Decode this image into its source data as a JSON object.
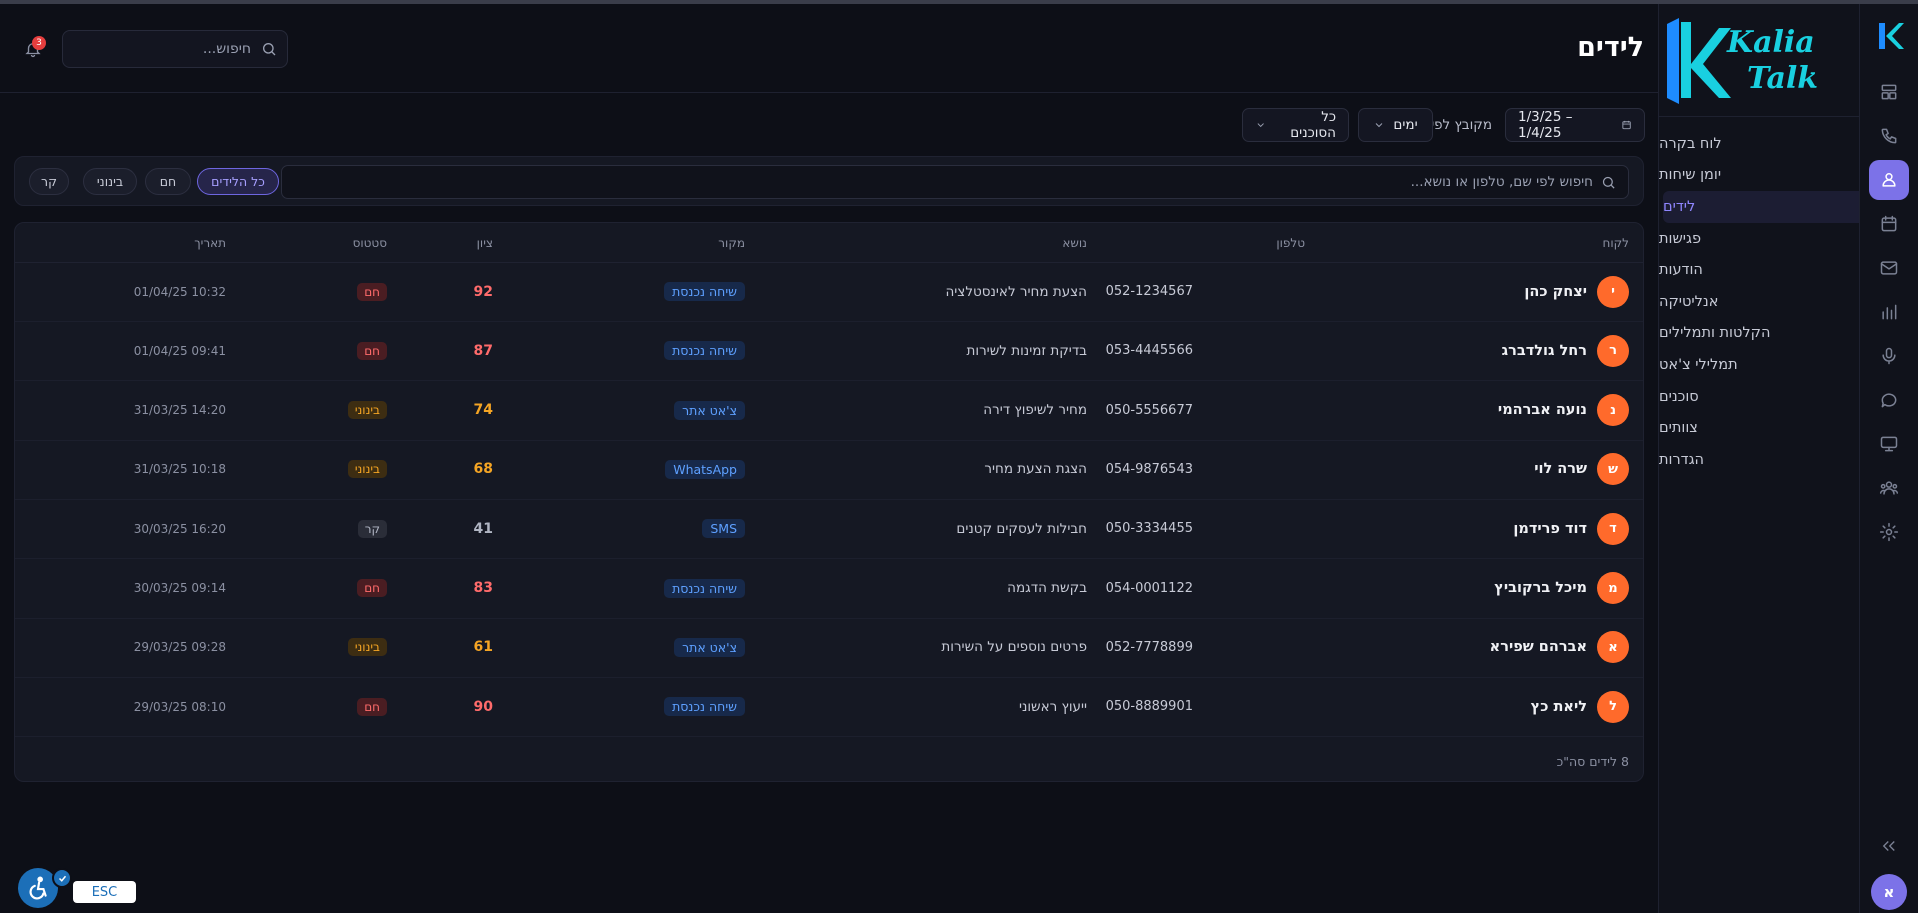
{
  "app": {
    "brand_line1": "Kalia",
    "brand_line2": "Talk",
    "user_initial": "א"
  },
  "colors": {
    "accent": "#7c72e8",
    "avatar": "#ff6a2b",
    "hot": "#ff6b6b",
    "mid": "#f5a524",
    "cold": "#b0b5c3",
    "source": "#5ea0ff"
  },
  "rail_icons": [
    "dashboard-icon",
    "phone-icon",
    "leads-icon",
    "calendar-icon",
    "mail-icon",
    "analytics-icon",
    "mic-icon",
    "chat-icon",
    "monitor-icon",
    "agents-icon",
    "settings-icon"
  ],
  "nav": {
    "items": [
      {
        "label": "לוח בקרה",
        "active": false
      },
      {
        "label": "יומן שיחות",
        "active": false
      },
      {
        "label": "לידים",
        "active": true
      },
      {
        "label": "פגישות",
        "active": false
      },
      {
        "label": "הודעות",
        "active": false
      },
      {
        "label": "אנליטיקה",
        "active": false
      },
      {
        "label": "הקלטות ותמלילים",
        "active": false
      },
      {
        "label": "תמלילי צ'אט",
        "active": false
      },
      {
        "label": "סוכנים",
        "active": false
      },
      {
        "label": "צוותים",
        "active": false
      },
      {
        "label": "הגדרות",
        "active": false
      }
    ]
  },
  "header": {
    "title": "לידים",
    "search_placeholder": "חיפוש...",
    "notifications_count": "3"
  },
  "filters": {
    "date_range": "1/3/25 – 1/4/25",
    "group_label": "מקובץ לפי",
    "group_value": "ימים",
    "agents_value": "כל הסוכנים"
  },
  "lead_search": {
    "placeholder": "חיפוש לפי שם, טלפון או נושא...",
    "chips": [
      {
        "label": "כל הלידים",
        "active": true
      },
      {
        "label": "חם",
        "active": false
      },
      {
        "label": "בינוני",
        "active": false
      },
      {
        "label": "קר",
        "active": false
      }
    ]
  },
  "table": {
    "columns": {
      "customer": "לקוח",
      "phone": "טלפון",
      "topic": "נושא",
      "source": "מקור",
      "score": "ציון",
      "status": "סטטוס",
      "date": "תאריך"
    },
    "rows": [
      {
        "initial": "י",
        "name": "יצחק כהן",
        "phone": "052-1234567",
        "topic": "הצעת מחיר לאינסטלציה",
        "source": "שיחה נכנסת",
        "score": "92",
        "status": "חם",
        "level": "hot",
        "date": "01/04/25 10:32"
      },
      {
        "initial": "ר",
        "name": "רחל גולדברג",
        "phone": "053-4445566",
        "topic": "בדיקת זמינות לשירות",
        "source": "שיחה נכנסת",
        "score": "87",
        "status": "חם",
        "level": "hot",
        "date": "01/04/25 09:41"
      },
      {
        "initial": "נ",
        "name": "נועה אברהמי",
        "phone": "050-5556677",
        "topic": "מחיר לשיפוץ דירה",
        "source": "צ'אט אתר",
        "score": "74",
        "status": "בינוני",
        "level": "mid",
        "date": "31/03/25 14:20"
      },
      {
        "initial": "ש",
        "name": "שרה לוי",
        "phone": "054-9876543",
        "topic": "הצגת הצעת מחיר",
        "source": "WhatsApp",
        "score": "68",
        "status": "בינוני",
        "level": "mid",
        "date": "31/03/25 10:18"
      },
      {
        "initial": "ד",
        "name": "דוד פרידמן",
        "phone": "050-3334455",
        "topic": "חבילות לעסקים קטנים",
        "source": "SMS",
        "score": "41",
        "status": "קר",
        "level": "cold",
        "date": "30/03/25 16:20"
      },
      {
        "initial": "מ",
        "name": "מיכל ברקוביץ",
        "phone": "054-0001122",
        "topic": "בקשת הדגמה",
        "source": "שיחה נכנסת",
        "score": "83",
        "status": "חם",
        "level": "hot",
        "date": "30/03/25 09:14"
      },
      {
        "initial": "א",
        "name": "אברהם שפירא",
        "phone": "052-7778899",
        "topic": "פרטים נוספים על השירות",
        "source": "צ'אט אתר",
        "score": "61",
        "status": "בינוני",
        "level": "mid",
        "date": "29/03/25 09:28"
      },
      {
        "initial": "ל",
        "name": "ליאת כץ",
        "phone": "050-8889901",
        "topic": "ייעוץ ראשוני",
        "source": "שיחה נכנסת",
        "score": "90",
        "status": "חם",
        "level": "hot",
        "date": "29/03/25 08:10"
      }
    ],
    "footer": "8 לידים סה\"כ"
  },
  "accessibility": {
    "esc_label": "ESC"
  }
}
